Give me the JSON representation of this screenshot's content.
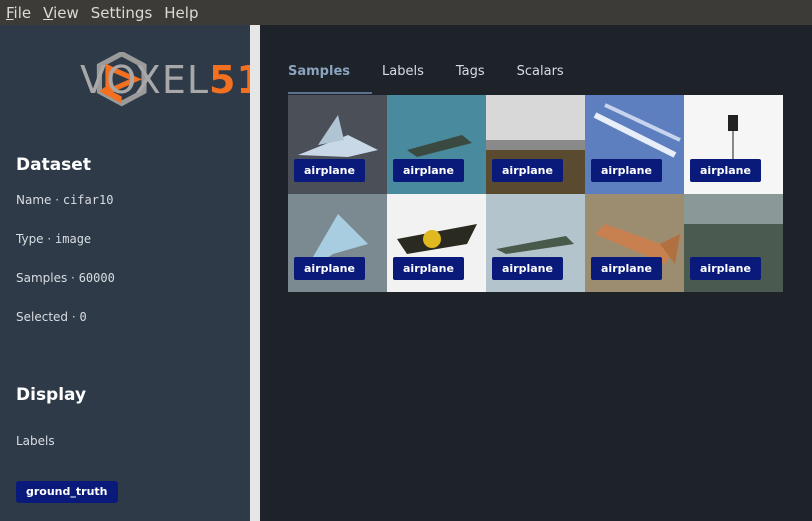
{
  "menubar": {
    "items": [
      {
        "pre": "",
        "u": "F",
        "post": "ile"
      },
      {
        "pre": "",
        "u": "V",
        "post": "iew"
      },
      {
        "pre": "",
        "u": "",
        "post": "Settings"
      },
      {
        "pre": "",
        "u": "",
        "post": "Help"
      }
    ]
  },
  "logo": {
    "voxel": "VOXEL",
    "num": "51"
  },
  "dataset": {
    "title": "Dataset",
    "name_label": "Name ·",
    "name_value": "cifar10",
    "type_label": "Type ·",
    "type_value": "image",
    "samples_label": "Samples ·",
    "samples_value": "60000",
    "selected_label": "Selected ·",
    "selected_value": "0"
  },
  "display": {
    "title": "Display",
    "labels_label": "Labels",
    "ground_truth": "ground_truth"
  },
  "tabs": [
    "Samples",
    "Labels",
    "Tags",
    "Scalars"
  ],
  "samples": [
    {
      "label": "airplane",
      "bg": "#4a4f58"
    },
    {
      "label": "airplane",
      "bg": "#4a8a9e"
    },
    {
      "label": "airplane",
      "bg": "#8a8a8a"
    },
    {
      "label": "airplane",
      "bg": "#5d7fbf"
    },
    {
      "label": "airplane",
      "bg": "#f6f6f6"
    },
    {
      "label": "airplane",
      "bg": "#7b8a90"
    },
    {
      "label": "airplane",
      "bg": "#f2f2f2"
    },
    {
      "label": "airplane",
      "bg": "#b4c4cc"
    },
    {
      "label": "airplane",
      "bg": "#9c8c70"
    },
    {
      "label": "airplane",
      "bg": "#5a6460"
    }
  ]
}
